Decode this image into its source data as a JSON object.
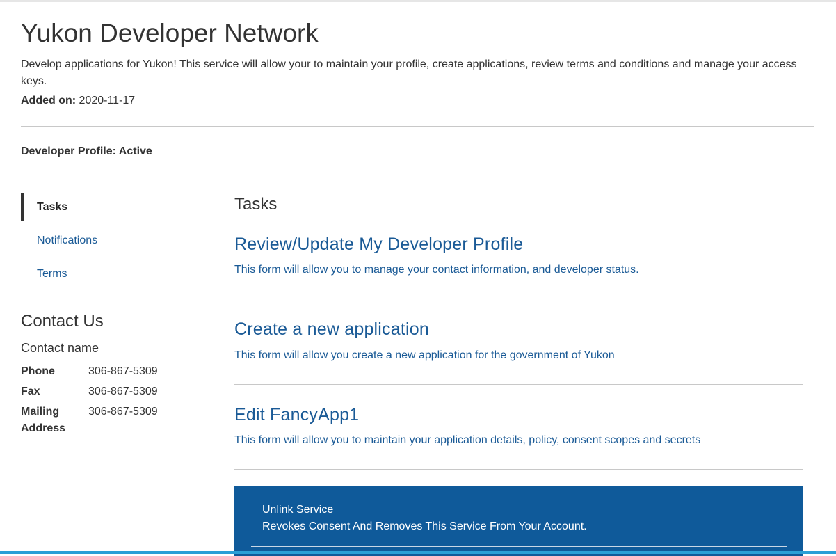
{
  "service": {
    "title": "Yukon Developer Network",
    "description": "Develop applications for Yukon! This service will allow your to maintain your profile, create applications, review terms and conditions and manage your access keys.",
    "added_label": "Added on:",
    "added_date": "2020-11-17"
  },
  "profile_status": "Developer Profile: Active",
  "sidenav": {
    "items": [
      {
        "label": "Tasks"
      },
      {
        "label": "Notifications"
      },
      {
        "label": "Terms"
      }
    ]
  },
  "contact": {
    "title": "Contact Us",
    "name": "Contact name",
    "rows": [
      {
        "label": "Phone",
        "value": "306-867-5309"
      },
      {
        "label": "Fax",
        "value": "306-867-5309"
      },
      {
        "label": "Mailing Address",
        "value": "306-867-5309"
      }
    ]
  },
  "main": {
    "title": "Tasks",
    "tasks": [
      {
        "title": "Review/Update My Developer Profile",
        "description": "This form will allow you to manage your contact information, and developer status."
      },
      {
        "title": "Create a new application",
        "description": "This form will allow you create a new application for the government of Yukon"
      },
      {
        "title": "Edit FancyApp1",
        "description": "This form will allow you to maintain your application details, policy, consent scopes and secrets"
      }
    ]
  },
  "unlink": {
    "title": "Unlink Service",
    "description": "Revokes Consent And Removes This Service From Your Account."
  },
  "colors": {
    "link": "#1a5a96",
    "unlink_bg": "#0f5a9a",
    "bottom_bar": "#2a9fd6"
  }
}
